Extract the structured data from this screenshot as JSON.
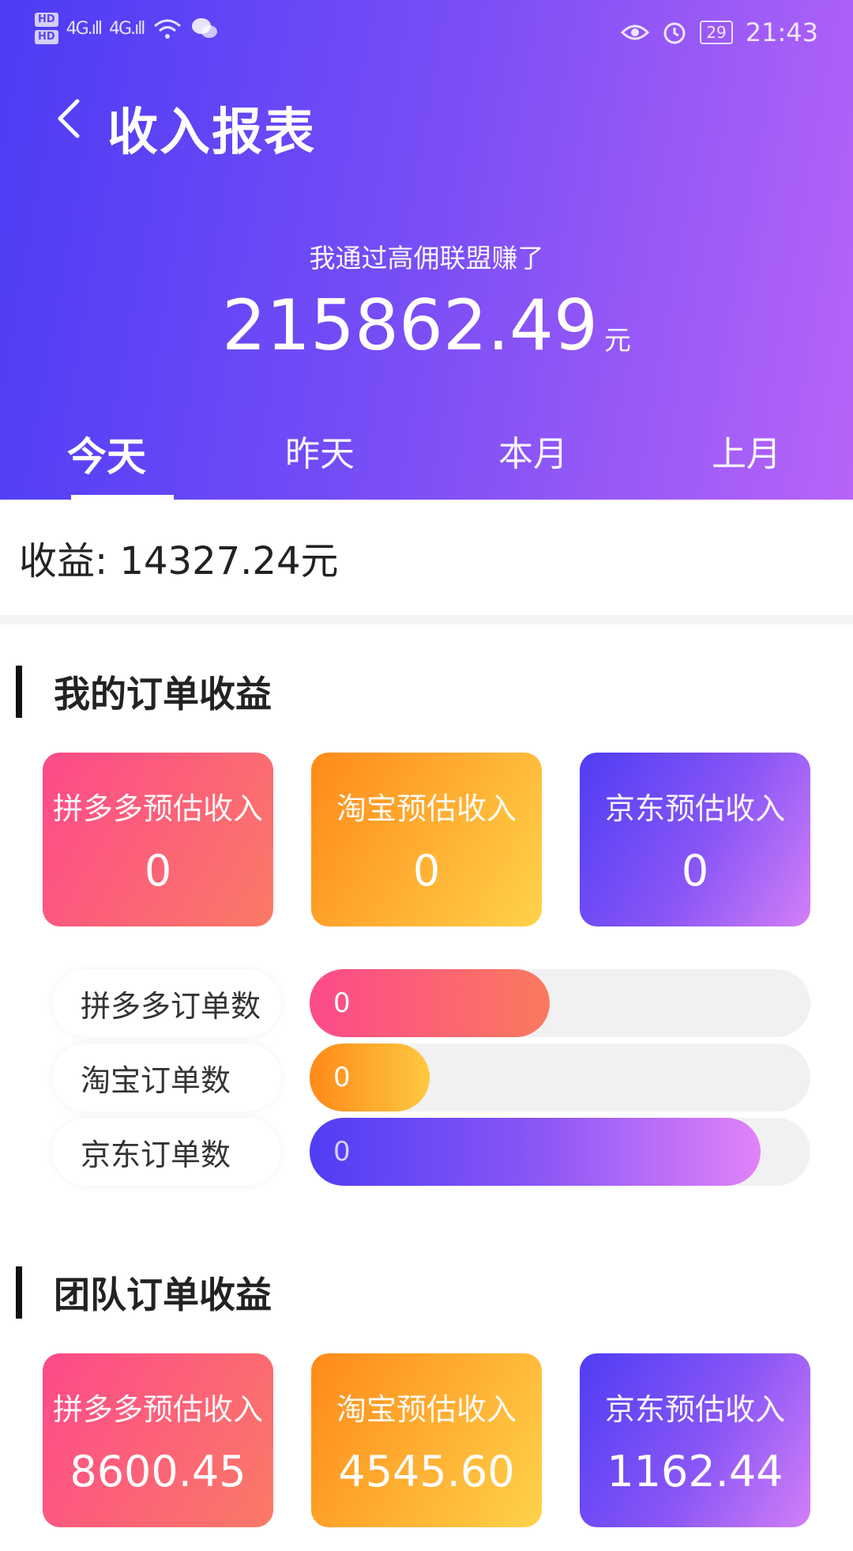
{
  "status_bar": {
    "hd1": "HD",
    "hd2": "HD",
    "signal1": "4G.ıll",
    "signal2": "4G.ıll",
    "battery": "29",
    "time": "21:43",
    "icons": [
      "hd-icon",
      "signal-icon",
      "wifi-icon",
      "wechat-icon",
      "eye-icon",
      "alarm-icon",
      "battery-icon"
    ]
  },
  "header": {
    "title": "收入报表",
    "earn_caption": "我通过高佣联盟赚了",
    "earn_value": "215862.49",
    "earn_unit": "元"
  },
  "tabs": [
    "今天",
    "昨天",
    "本月",
    "上月"
  ],
  "active_tab": "今天",
  "income": {
    "label": "收益:",
    "value": "14327.24元"
  },
  "my_orders": {
    "title": "我的订单收益",
    "cards": [
      {
        "label": "拼多多预估收入",
        "value": "0"
      },
      {
        "label": "淘宝预估收入",
        "value": "0"
      },
      {
        "label": "京东预估收入",
        "value": "0"
      }
    ],
    "bars": [
      {
        "label": "拼多多订单数",
        "value": "0",
        "fill_fraction": 0.48
      },
      {
        "label": "淘宝订单数",
        "value": "0",
        "fill_fraction": 0.24
      },
      {
        "label": "京东订单数",
        "value": "0",
        "fill_fraction": 0.9
      }
    ]
  },
  "team_orders": {
    "title": "团队订单收益",
    "cards": [
      {
        "label": "拼多多预估收入",
        "value": "8600.45"
      },
      {
        "label": "淘宝预估收入",
        "value": "4545.60"
      },
      {
        "label": "京东预估收入",
        "value": "1162.44"
      }
    ]
  },
  "colors": {
    "header_start": "#4b3cf5",
    "header_end": "#b764f7",
    "pdd_start": "#fc4a8a",
    "pdd_end": "#fb7a66",
    "taobao_start": "#ff8a1a",
    "taobao_end": "#ffd24a",
    "jd_start": "#4f3df4",
    "jd_end": "#d27ff7"
  }
}
